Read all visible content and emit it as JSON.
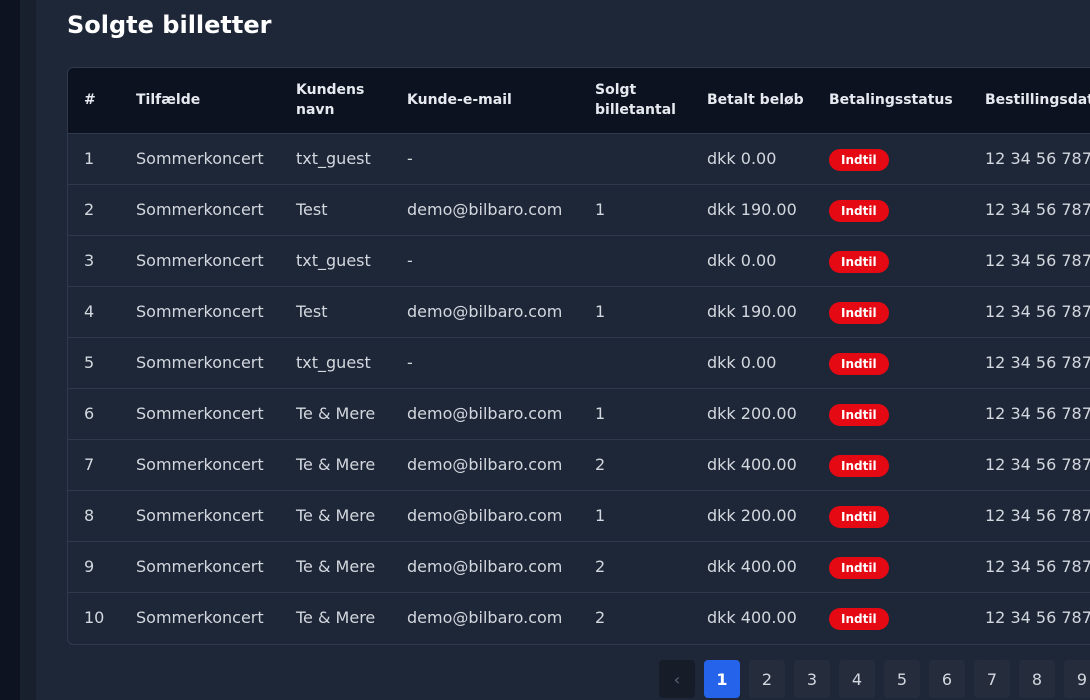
{
  "page": {
    "title": "Solgte billetter"
  },
  "table": {
    "columns": [
      "#",
      "Tilfælde",
      "Kundens navn",
      "Kunde-e-mail",
      "Solgt billetantal",
      "Betalt beløb",
      "Betalingsstatus",
      "Bestillingsdato"
    ],
    "rows": [
      {
        "num": "1",
        "event": "Sommerkoncert",
        "name": "txt_guest",
        "email": "-",
        "qty": "",
        "amount": "dkk 0.00",
        "status": "Indtil",
        "date": "12 34 56 787"
      },
      {
        "num": "2",
        "event": "Sommerkoncert",
        "name": "Test",
        "email": "demo@bilbaro.com",
        "qty": "1",
        "amount": "dkk 190.00",
        "status": "Indtil",
        "date": "12 34 56 787"
      },
      {
        "num": "3",
        "event": "Sommerkoncert",
        "name": "txt_guest",
        "email": "-",
        "qty": "",
        "amount": "dkk 0.00",
        "status": "Indtil",
        "date": "12 34 56 787"
      },
      {
        "num": "4",
        "event": "Sommerkoncert",
        "name": "Test",
        "email": "demo@bilbaro.com",
        "qty": "1",
        "amount": "dkk 190.00",
        "status": "Indtil",
        "date": "12 34 56 787"
      },
      {
        "num": "5",
        "event": "Sommerkoncert",
        "name": "txt_guest",
        "email": "-",
        "qty": "",
        "amount": "dkk 0.00",
        "status": "Indtil",
        "date": "12 34 56 787"
      },
      {
        "num": "6",
        "event": "Sommerkoncert",
        "name": "Te & Mere",
        "email": "demo@bilbaro.com",
        "qty": "1",
        "amount": "dkk 200.00",
        "status": "Indtil",
        "date": "12 34 56 787"
      },
      {
        "num": "7",
        "event": "Sommerkoncert",
        "name": "Te & Mere",
        "email": "demo@bilbaro.com",
        "qty": "2",
        "amount": "dkk 400.00",
        "status": "Indtil",
        "date": "12 34 56 787"
      },
      {
        "num": "8",
        "event": "Sommerkoncert",
        "name": "Te & Mere",
        "email": "demo@bilbaro.com",
        "qty": "1",
        "amount": "dkk 200.00",
        "status": "Indtil",
        "date": "12 34 56 787"
      },
      {
        "num": "9",
        "event": "Sommerkoncert",
        "name": "Te & Mere",
        "email": "demo@bilbaro.com",
        "qty": "2",
        "amount": "dkk 400.00",
        "status": "Indtil",
        "date": "12 34 56 787"
      },
      {
        "num": "10",
        "event": "Sommerkoncert",
        "name": "Te & Mere",
        "email": "demo@bilbaro.com",
        "qty": "2",
        "amount": "dkk 400.00",
        "status": "Indtil",
        "date": "12 34 56 787"
      }
    ]
  },
  "pagination": {
    "prev_label": "‹",
    "pages": [
      "1",
      "2",
      "3",
      "4",
      "5",
      "6",
      "7",
      "8",
      "9"
    ],
    "current": "1"
  },
  "colors": {
    "background": "#1e2738",
    "header_background": "#0d1220",
    "status_badge": "#e50914",
    "active_page": "#2563eb"
  }
}
